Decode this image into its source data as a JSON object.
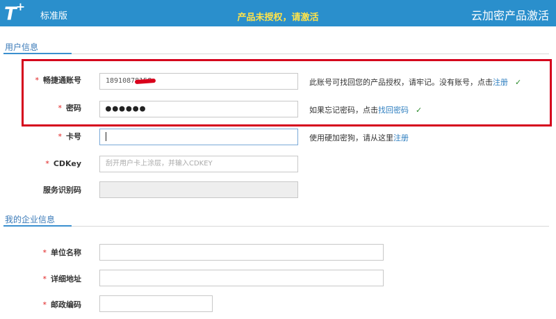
{
  "header": {
    "logo": "T",
    "logo_sup": "+",
    "edition": "标准版",
    "notice": "产品未授权，请激活",
    "brand": "云加密产品激活"
  },
  "user_section": {
    "title": "用户信息",
    "fields": {
      "account": {
        "label": "畅捷通账号",
        "value": "18910878158",
        "hint": "此账号可找回您的产品授权，请牢记。没有账号，点击",
        "link": "注册",
        "check": "✓"
      },
      "password": {
        "label": "密码",
        "value": "●●●●●●",
        "hint": "如果忘记密码，点击",
        "link": "找回密码",
        "check": "✓"
      },
      "card": {
        "label": "卡号",
        "value": "",
        "hint": "使用硬加密狗，请从这里",
        "link": "注册"
      },
      "cdkey": {
        "label": "CDKey",
        "placeholder": "刮开用户卡上涂层，并输入CDKEY"
      },
      "service_code": {
        "label": "服务识别码",
        "value": ""
      }
    }
  },
  "company_section": {
    "title": "我的企业信息",
    "fields": {
      "company_name": {
        "label": "单位名称",
        "value": ""
      },
      "address": {
        "label": "详细地址",
        "value": ""
      },
      "postcode": {
        "label": "邮政编码",
        "value": ""
      }
    }
  },
  "required_mark": "*",
  "colors": {
    "header_bg": "#2a8fcc",
    "notice": "#ffe34a",
    "highlight_border": "#d5001c",
    "link": "#2f7fc0"
  }
}
